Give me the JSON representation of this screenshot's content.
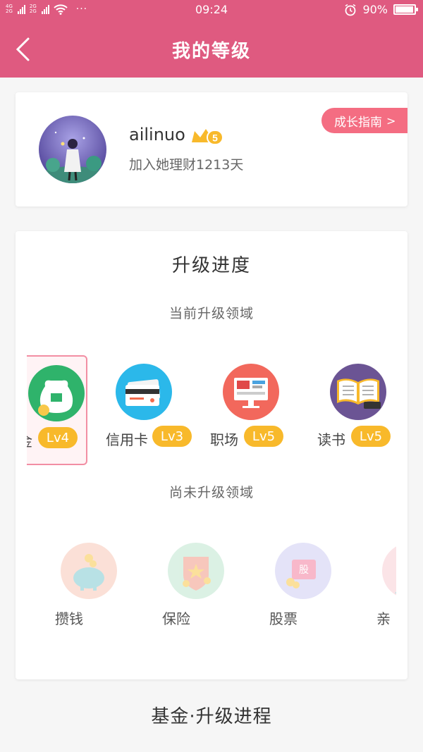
{
  "status_bar": {
    "time": "09:24",
    "battery": "90%",
    "battery_level": 0.9,
    "network_a": "4G",
    "network_b": "2G",
    "more": "···"
  },
  "header": {
    "title": "我的等级"
  },
  "profile": {
    "username": "ailinuo",
    "level_badge": "5",
    "joined": "加入她理财1213天",
    "guide_button": "成长指南"
  },
  "progress": {
    "title": "升级进度",
    "current_label": "当前升级领域",
    "current_items": [
      {
        "label": "金",
        "level": "Lv4",
        "icon": "money-bag-icon",
        "color": "#2fb36b"
      },
      {
        "label": "信用卡",
        "level": "Lv3",
        "icon": "credit-card-icon",
        "color": "#2bb8ea"
      },
      {
        "label": "职场",
        "level": "Lv5",
        "icon": "monitor-icon",
        "color": "#f2685c"
      },
      {
        "label": "读书",
        "level": "Lv5",
        "icon": "book-icon",
        "color": "#6b5494"
      }
    ],
    "pending_label": "尚未升级领域",
    "pending_items": [
      {
        "label": "攒钱",
        "icon": "piggy-bank-icon",
        "color": "#f8c8b8"
      },
      {
        "label": "保险",
        "icon": "shield-star-icon",
        "color": "#bfe6cf"
      },
      {
        "label": "股票",
        "icon": "stock-icon",
        "color": "#cfcdf3"
      },
      {
        "label": "亲",
        "icon": "person-icon",
        "color": "#f9cfd5"
      }
    ]
  },
  "bottom": {
    "title": "基金·升级进程"
  },
  "colors": {
    "brand": "#df5a80",
    "badge": "#f8b92b",
    "guide": "#f46d82"
  }
}
